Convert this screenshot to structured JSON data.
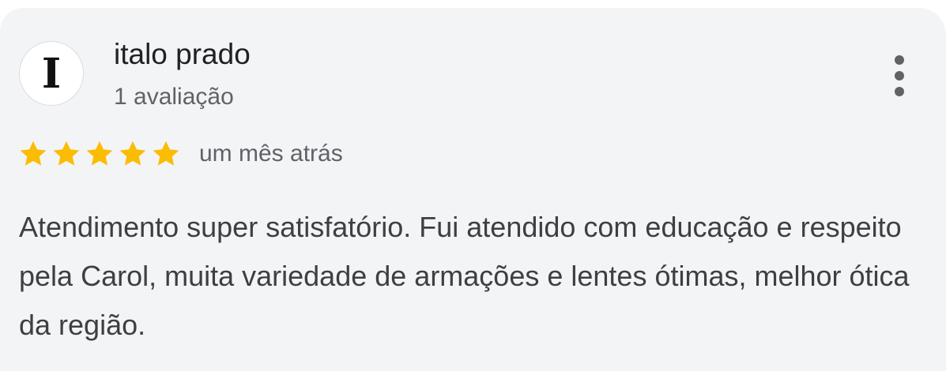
{
  "review": {
    "avatar_initial": "I",
    "reviewer_name": "italo prado",
    "reviewer_meta": "1 avaliação",
    "rating": 5,
    "rating_max": 5,
    "date": "um mês atrás",
    "text": "Atendimento super satisfatório. Fui atendido com educação e respeito pela Carol, muita variedade de armações e lentes ótimas, melhor ótica da região.",
    "more_icon": "more-vert-icon",
    "star_icon": "star-icon"
  },
  "colors": {
    "card_background": "#f3f4f6",
    "star": "#fbbc04",
    "primary_text": "#202124",
    "secondary_text": "#5f6368"
  }
}
